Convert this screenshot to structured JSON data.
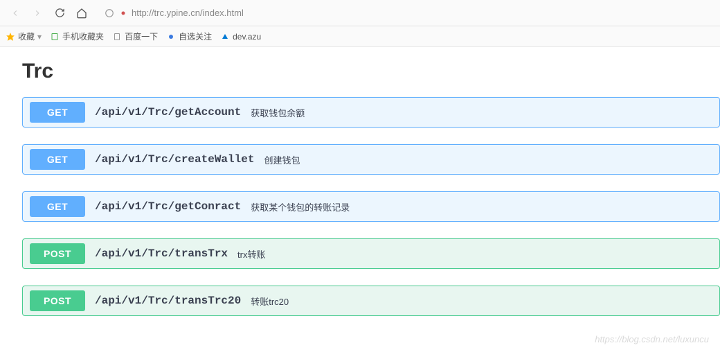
{
  "browser": {
    "url": "http://trc.ypine.cn/index.html"
  },
  "bookmarks": {
    "favorites_label": "收藏",
    "items": [
      {
        "label": "手机收藏夹"
      },
      {
        "label": "百度一下"
      },
      {
        "label": "自选关注"
      },
      {
        "label": "dev.azu"
      }
    ]
  },
  "page": {
    "title": "Trc"
  },
  "apis": [
    {
      "method": "GET",
      "path": "/api/v1/Trc/getAccount",
      "desc": "获取钱包余额"
    },
    {
      "method": "GET",
      "path": "/api/v1/Trc/createWallet",
      "desc": "创建钱包"
    },
    {
      "method": "GET",
      "path": "/api/v1/Trc/getConract",
      "desc": "获取某个钱包的转账记录"
    },
    {
      "method": "POST",
      "path": "/api/v1/Trc/transTrx",
      "desc": "trx转账"
    },
    {
      "method": "POST",
      "path": "/api/v1/Trc/transTrc20",
      "desc": "转账trc20"
    }
  ],
  "watermark": "https://blog.csdn.net/luxuncu"
}
